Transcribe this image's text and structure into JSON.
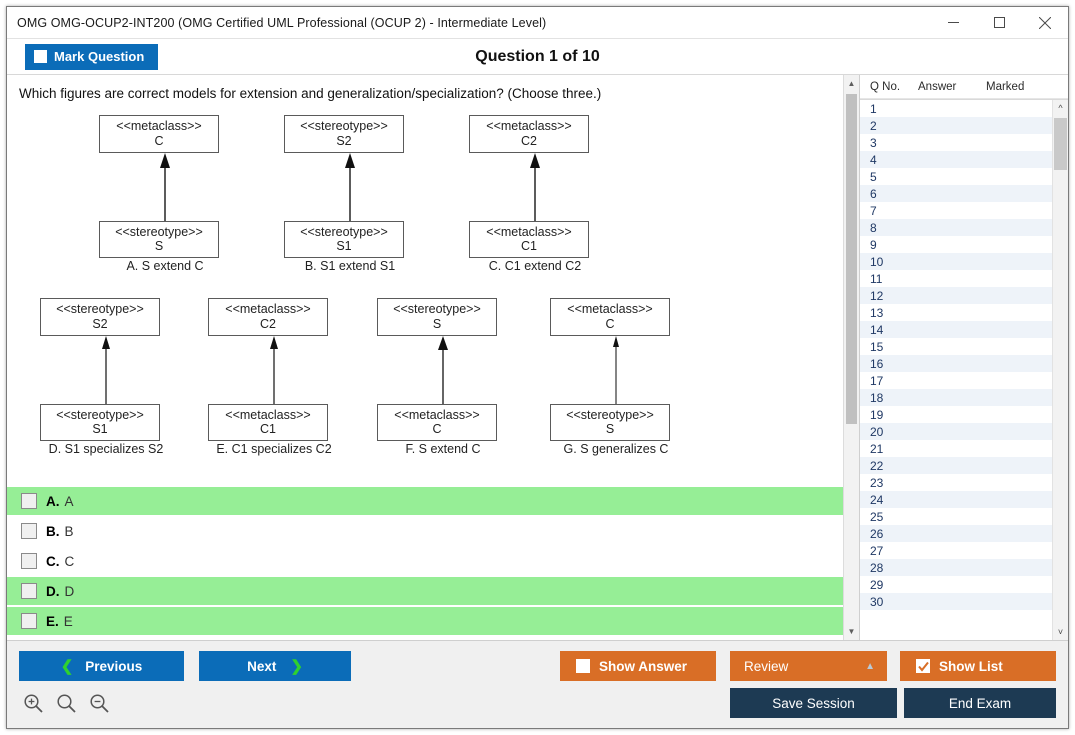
{
  "window": {
    "title": "OMG OMG-OCUP2-INT200 (OMG Certified UML Professional (OCUP 2) - Intermediate Level)",
    "minimize_icon": "minimize-icon",
    "maximize_icon": "maximize-icon",
    "close_icon": "close-icon"
  },
  "header": {
    "mark_question_label": "Mark Question",
    "question_counter": "Question 1 of 10"
  },
  "question": {
    "text": "Which figures are correct models for extension and generalization/specialization? (Choose three.)",
    "figures": [
      {
        "id": "A",
        "top_stereotype": "<<metaclass>>",
        "top_name": "C",
        "bottom_stereotype": "<<stereotype>>",
        "bottom_name": "S",
        "caption": "A. S extend C"
      },
      {
        "id": "B",
        "top_stereotype": "<<stereotype>>",
        "top_name": "S2",
        "bottom_stereotype": "<<stereotype>>",
        "bottom_name": "S1",
        "caption": "B. S1 extend S1"
      },
      {
        "id": "C",
        "top_stereotype": "<<metaclass>>",
        "top_name": "C2",
        "bottom_stereotype": "<<metaclass>>",
        "bottom_name": "C1",
        "caption": "C. C1 extend C2"
      },
      {
        "id": "D",
        "top_stereotype": "<<stereotype>>",
        "top_name": "S2",
        "bottom_stereotype": "<<stereotype>>",
        "bottom_name": "S1",
        "caption": "D. S1 specializes S2"
      },
      {
        "id": "E",
        "top_stereotype": "<<metaclass>>",
        "top_name": "C2",
        "bottom_stereotype": "<<metaclass>>",
        "bottom_name": "C1",
        "caption": "E. C1 specializes C2"
      },
      {
        "id": "F",
        "top_stereotype": "<<stereotype>>",
        "top_name": "S",
        "bottom_stereotype": "<<metaclass>>",
        "bottom_name": "C",
        "caption": "F. S extend C"
      },
      {
        "id": "G",
        "top_stereotype": "<<metaclass>>",
        "top_name": "C",
        "bottom_stereotype": "<<stereotype>>",
        "bottom_name": "S",
        "caption": "G. S generalizes C"
      }
    ],
    "options": [
      {
        "letter": "A.",
        "text": "A",
        "correct": true
      },
      {
        "letter": "B.",
        "text": "B",
        "correct": false
      },
      {
        "letter": "C.",
        "text": "C",
        "correct": false
      },
      {
        "letter": "D.",
        "text": "D",
        "correct": true
      },
      {
        "letter": "E.",
        "text": "E",
        "correct": true
      }
    ]
  },
  "list_panel": {
    "columns": [
      "Q No.",
      "Answer",
      "Marked"
    ],
    "rows": [
      {
        "qno": "1",
        "answer": "",
        "marked": ""
      },
      {
        "qno": "2",
        "answer": "",
        "marked": ""
      },
      {
        "qno": "3",
        "answer": "",
        "marked": ""
      },
      {
        "qno": "4",
        "answer": "",
        "marked": ""
      },
      {
        "qno": "5",
        "answer": "",
        "marked": ""
      },
      {
        "qno": "6",
        "answer": "",
        "marked": ""
      },
      {
        "qno": "7",
        "answer": "",
        "marked": ""
      },
      {
        "qno": "8",
        "answer": "",
        "marked": ""
      },
      {
        "qno": "9",
        "answer": "",
        "marked": ""
      },
      {
        "qno": "10",
        "answer": "",
        "marked": ""
      },
      {
        "qno": "11",
        "answer": "",
        "marked": ""
      },
      {
        "qno": "12",
        "answer": "",
        "marked": ""
      },
      {
        "qno": "13",
        "answer": "",
        "marked": ""
      },
      {
        "qno": "14",
        "answer": "",
        "marked": ""
      },
      {
        "qno": "15",
        "answer": "",
        "marked": ""
      },
      {
        "qno": "16",
        "answer": "",
        "marked": ""
      },
      {
        "qno": "17",
        "answer": "",
        "marked": ""
      },
      {
        "qno": "18",
        "answer": "",
        "marked": ""
      },
      {
        "qno": "19",
        "answer": "",
        "marked": ""
      },
      {
        "qno": "20",
        "answer": "",
        "marked": ""
      },
      {
        "qno": "21",
        "answer": "",
        "marked": ""
      },
      {
        "qno": "22",
        "answer": "",
        "marked": ""
      },
      {
        "qno": "23",
        "answer": "",
        "marked": ""
      },
      {
        "qno": "24",
        "answer": "",
        "marked": ""
      },
      {
        "qno": "25",
        "answer": "",
        "marked": ""
      },
      {
        "qno": "26",
        "answer": "",
        "marked": ""
      },
      {
        "qno": "27",
        "answer": "",
        "marked": ""
      },
      {
        "qno": "28",
        "answer": "",
        "marked": ""
      },
      {
        "qno": "29",
        "answer": "",
        "marked": ""
      },
      {
        "qno": "30",
        "answer": "",
        "marked": ""
      }
    ]
  },
  "footer": {
    "previous_label": "Previous",
    "next_label": "Next",
    "show_answer_label": "Show Answer",
    "show_answer_checked": false,
    "review_label": "Review",
    "show_list_label": "Show List",
    "show_list_checked": true,
    "save_session_label": "Save Session",
    "end_exam_label": "End Exam",
    "zoom_icons": [
      "zoom-in-icon",
      "zoom-reset-icon",
      "zoom-out-icon"
    ]
  },
  "colors": {
    "blue": "#0b6cb8",
    "orange": "#d96e26",
    "navy": "#1d3a53",
    "correct_green": "#96ee96",
    "chevron_green": "#2fd12f"
  }
}
